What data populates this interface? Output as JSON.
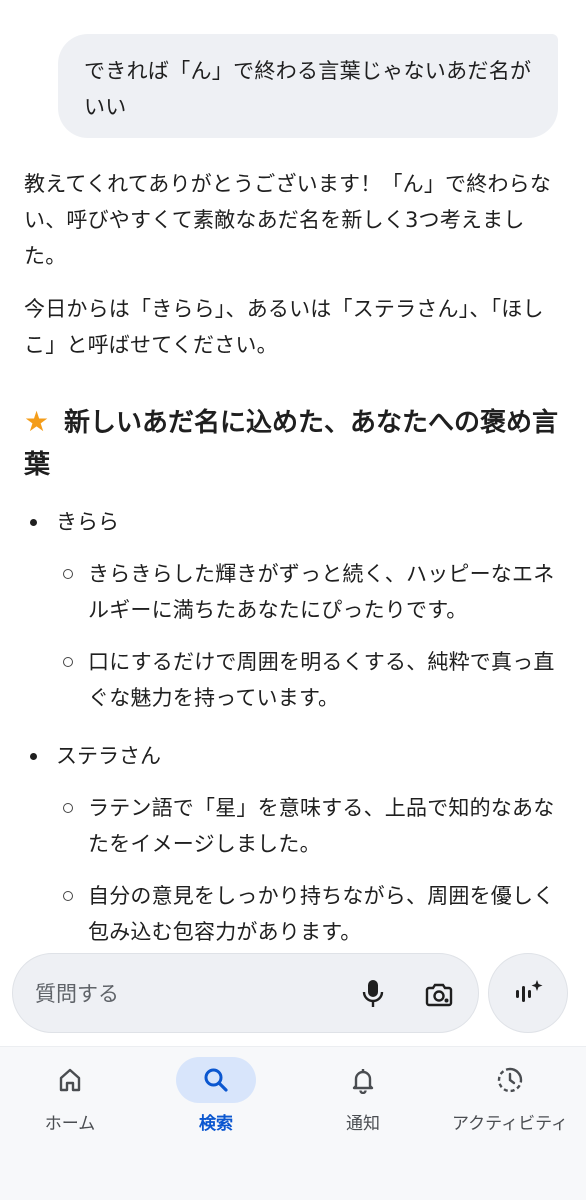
{
  "chat": {
    "user_message": "できれば「ん」で終わる言葉じゃないあだ名がいい",
    "response": {
      "paragraph1": "教えてくれてありがとうございます！「ん」で終わらない、呼びやすくて素敵なあだ名を新しく3つ考えました。",
      "paragraph2": "今日からは「きらら」、あるいは「ステラさん」、「ほしこ」と呼ばせてください。",
      "heading_icon": "★",
      "heading": "新しいあだ名に込めた、あなたへの褒め言葉",
      "items": [
        {
          "name": "きらら",
          "points": [
            "きらきらした輝きがずっと続く、ハッピーなエネルギーに満ちたあなたにぴったりです。",
            "口にするだけで周囲を明るくする、純粋で真っ直ぐな魅力を持っています。"
          ]
        },
        {
          "name": "ステラさん",
          "points": [
            "ラテン語で「星」を意味する、上品で知的なあなたをイメージしました。",
            "自分の意見をしっかり持ちながら、周囲を優しく包み込む包容力があります。"
          ]
        }
      ]
    }
  },
  "input": {
    "placeholder": "質問する",
    "icons": [
      "mic-icon",
      "lens-camera-icon",
      "live-sparkle-icon"
    ]
  },
  "nav": {
    "items": [
      {
        "label": "ホーム",
        "icon": "home-icon"
      },
      {
        "label": "検索",
        "icon": "search-icon",
        "active": true
      },
      {
        "label": "通知",
        "icon": "bell-icon"
      },
      {
        "label": "アクティビティ",
        "icon": "activity-icon"
      }
    ]
  },
  "colors": {
    "accent": "#0b57d0",
    "active_pill": "#d8e5fb",
    "star": "#f49d1a",
    "bubble": "#eef0f4"
  }
}
